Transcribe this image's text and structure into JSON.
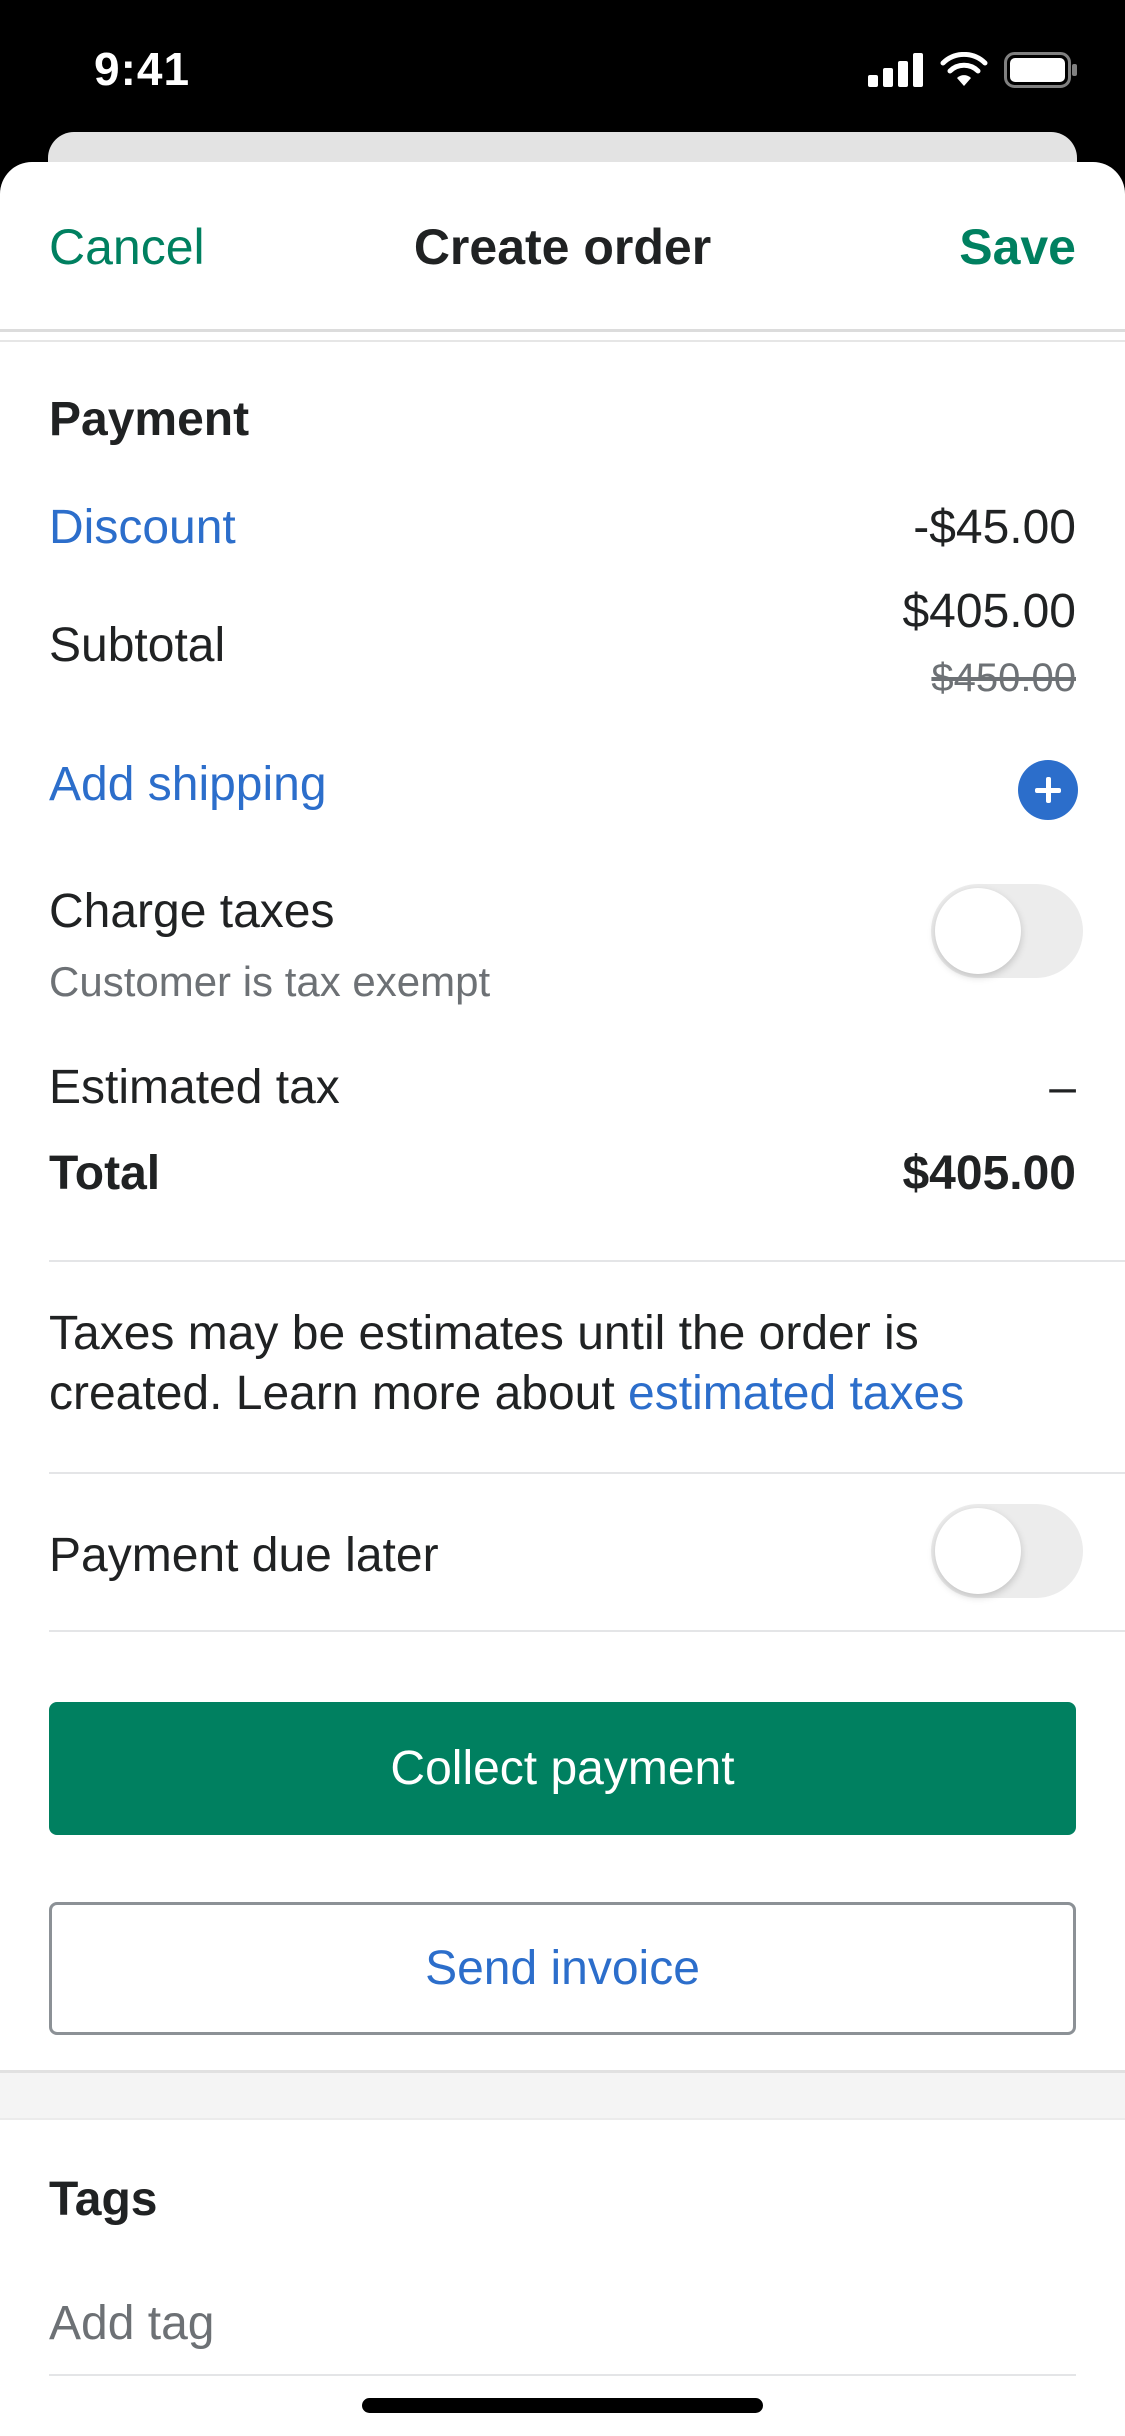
{
  "status_bar": {
    "time": "9:41"
  },
  "nav": {
    "cancel": "Cancel",
    "title": "Create order",
    "save": "Save"
  },
  "payment": {
    "title": "Payment",
    "discount_label": "Discount",
    "discount_value": "-$45.00",
    "subtotal_label": "Subtotal",
    "subtotal_value": "$405.00",
    "subtotal_original": "$450.00",
    "shipping_label": "Add shipping",
    "charge_taxes_label": "Charge taxes",
    "charge_taxes_sub": "Customer is tax exempt",
    "charge_taxes_on": false,
    "estimated_tax_label": "Estimated tax",
    "estimated_tax_value": "–",
    "total_label": "Total",
    "total_value": "$405.00"
  },
  "info": {
    "text": "Taxes may be estimates until the order is created. Learn more about ",
    "link": "estimated taxes"
  },
  "payment_due": {
    "label": "Payment due later",
    "on": false
  },
  "actions": {
    "collect": "Collect payment",
    "invoice": "Send invoice"
  },
  "tags": {
    "title": "Tags",
    "placeholder": "Add tag"
  },
  "colors": {
    "primary_green": "#008060",
    "link_blue": "#2c6ecb",
    "text": "#202223",
    "muted": "#6d7175"
  }
}
